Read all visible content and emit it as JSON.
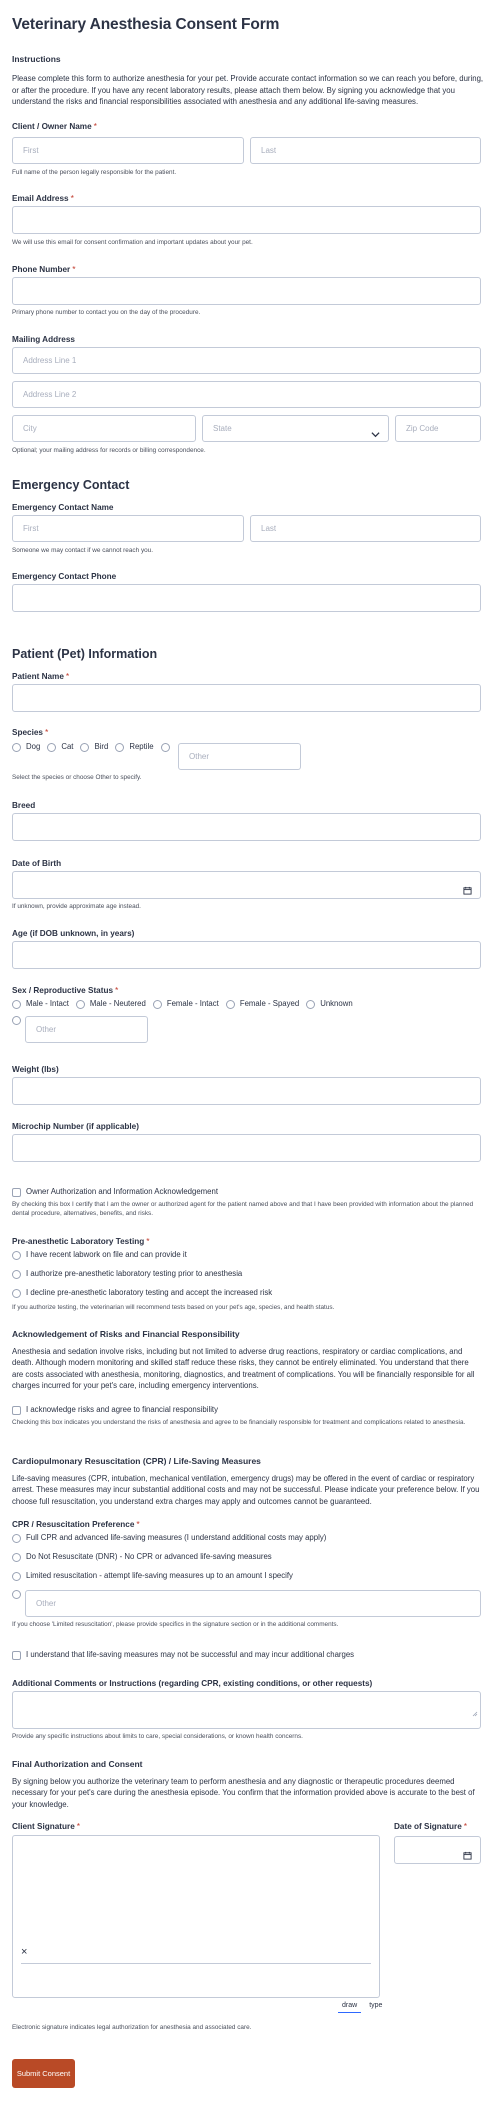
{
  "form_title": "Veterinary Anesthesia Consent Form",
  "instructions": {
    "heading": "Instructions",
    "text": "Please complete this form to authorize anesthesia for your pet. Provide accurate contact information so we can reach you before, during, or after the procedure. If you have any recent laboratory results, please attach them below. By signing you acknowledge that you understand the risks and financial responsibilities associated with anesthesia and any additional life-saving measures."
  },
  "owner_name": {
    "label": "Client / Owner Name",
    "required_mark": "*",
    "first_placeholder": "First",
    "last_placeholder": "Last",
    "help": "Full name of the person legally responsible for the patient."
  },
  "email": {
    "label": "Email Address",
    "required_mark": "*",
    "help": "We will use this email for consent confirmation and important updates about your pet."
  },
  "phone": {
    "label": "Phone Number",
    "required_mark": "*",
    "help": "Primary phone number to contact you on the day of the procedure."
  },
  "mailing": {
    "label": "Mailing Address",
    "line1_placeholder": "Address Line 1",
    "line2_placeholder": "Address Line 2",
    "city_placeholder": "City",
    "state_placeholder": "State",
    "zip_placeholder": "Zip Code",
    "help": "Optional; your mailing address for records or billing correspondence."
  },
  "emergency": {
    "heading": "Emergency Contact",
    "name_label": "Emergency Contact Name",
    "first_placeholder": "First",
    "last_placeholder": "Last",
    "name_help": "Someone we may contact if we cannot reach you.",
    "phone_label": "Emergency Contact Phone"
  },
  "patient": {
    "heading": "Patient (Pet) Information",
    "name_label": "Patient Name",
    "required_mark": "*",
    "species_label": "Species",
    "species_options": [
      "Dog",
      "Cat",
      "Bird",
      "Reptile"
    ],
    "species_other_placeholder": "Other",
    "species_help": "Select the species or choose Other to specify.",
    "breed_label": "Breed",
    "dob_label": "Date of Birth",
    "dob_help": "If unknown, provide approximate age instead.",
    "age_label": "Age (if DOB unknown, in years)",
    "sex_label": "Sex / Reproductive Status",
    "sex_options": [
      "Male - Intact",
      "Male - Neutered",
      "Female - Intact",
      "Female - Spayed",
      "Unknown"
    ],
    "sex_other_placeholder": "Other",
    "weight_label": "Weight (lbs)",
    "microchip_label": "Microchip Number (if applicable)"
  },
  "owner_auth": {
    "checkbox_label": "Owner Authorization and Information Acknowledgement",
    "help": "By checking this box I certify that I am the owner or authorized agent for the patient named above and that I have been provided with information about the planned dental procedure, alternatives, benefits, and risks."
  },
  "lab": {
    "label": "Pre-anesthetic Laboratory Testing",
    "required_mark": "*",
    "options": [
      "I have recent labwork on file and can provide it",
      "I authorize pre-anesthetic laboratory testing prior to anesthesia",
      "I decline pre-anesthetic laboratory testing and accept the increased risk"
    ],
    "help": "If you authorize testing, the veterinarian will recommend tests based on your pet's age, species, and health status."
  },
  "risks": {
    "heading": "Acknowledgement of Risks and Financial Responsibility",
    "text": "Anesthesia and sedation involve risks, including but not limited to adverse drug reactions, respiratory or cardiac complications, and death. Although modern monitoring and skilled staff reduce these risks, they cannot be entirely eliminated. You understand that there are costs associated with anesthesia, monitoring, diagnostics, and treatment of complications. You will be financially responsible for all charges incurred for your pet's care, including emergency interventions.",
    "checkbox_label": "I acknowledge risks and agree to financial responsibility",
    "help": "Checking this box indicates you understand the risks of anesthesia and agree to be financially responsible for treatment and complications related to anesthesia."
  },
  "cpr": {
    "heading": "Cardiopulmonary Resuscitation (CPR) / Life-Saving Measures",
    "text": "Life-saving measures (CPR, intubation, mechanical ventilation, emergency drugs) may be offered in the event of cardiac or respiratory arrest. These measures may incur substantial additional costs and may not be successful. Please indicate your preference below. If you choose full resuscitation, you understand extra charges may apply and outcomes cannot be guaranteed.",
    "pref_label": "CPR / Resuscitation Preference",
    "required_mark": "*",
    "options": [
      "Full CPR and advanced life-saving measures (I understand additional costs may apply)",
      "Do Not Resuscitate (DNR) - No CPR or advanced life-saving measures",
      "Limited resuscitation - attempt life-saving measures up to an amount I specify"
    ],
    "other_placeholder": "Other",
    "help": "If you choose 'Limited resuscitation', please provide specifics in the signature section or in the additional comments.",
    "understand_label": "I understand that life-saving measures may not be successful and may incur additional charges"
  },
  "comments": {
    "label": "Additional Comments or Instructions (regarding CPR, existing conditions, or other requests)",
    "help": "Provide any specific instructions about limits to care, special considerations, or known health concerns."
  },
  "final": {
    "heading": "Final Authorization and Consent",
    "text": "By signing below you authorize the veterinary team to perform anesthesia and any diagnostic or therapeutic procedures deemed necessary for your pet's care during the anesthesia episode. You confirm that the information provided above is accurate to the best of your knowledge.",
    "signature_label": "Client Signature",
    "signature_required": "*",
    "signature_x": "×",
    "tab_draw": "draw",
    "tab_type": "type",
    "date_label": "Date of Signature",
    "date_required": "*",
    "signature_help": "Electronic signature indicates legal authorization for anesthesia and associated care."
  },
  "submit_label": "Submit Consent",
  "colors": {
    "accent": "#b94a26",
    "required": "#c0392b",
    "border": "#c3cad8",
    "tab_underline": "#2e69ff"
  }
}
